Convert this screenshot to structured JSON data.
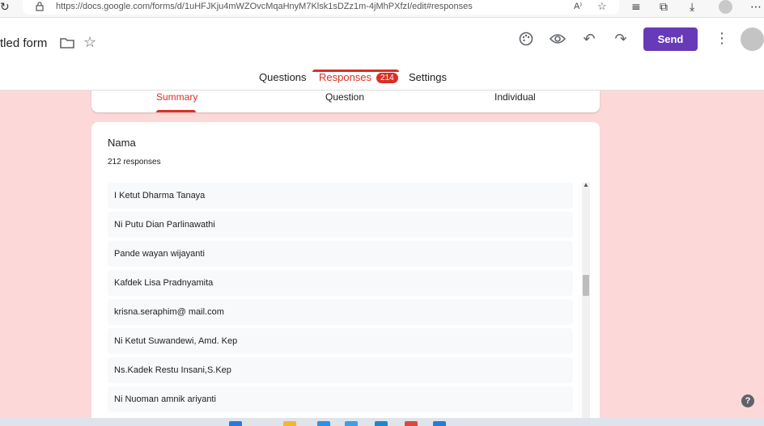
{
  "browser": {
    "url": "https://docs.google.com/forms/d/1uHFJKju4mWZOvcMqaHnyM7Klsk1sDZz1m-4jMhPXfzI/edit#responses"
  },
  "header": {
    "title": "tled form",
    "send_label": "Send"
  },
  "tabs": [
    {
      "label": "Questions"
    },
    {
      "label": "Responses",
      "badge": "214"
    },
    {
      "label": "Settings"
    }
  ],
  "subtabs": [
    {
      "label": "Summary"
    },
    {
      "label": "Question"
    },
    {
      "label": "Individual"
    }
  ],
  "question": {
    "title": "Nama",
    "count": "212 responses",
    "responses": [
      "I Ketut Dharma Tanaya",
      "Ni Putu Dian Parlinawathi",
      "Pande wayan wijayanti",
      "Kafdek Lisa Pradnyamita",
      "krisna.seraphim@ mail.com",
      "Ni Ketut Suwandewi, Amd. Kep",
      "Ns.Kadek Restu Insani,S.Kep",
      "Ni Nuoman amnik ariyanti"
    ]
  },
  "help_label": "?",
  "colors": {
    "accent": "#d93025",
    "send": "#673ab7",
    "background": "#fcd8d8"
  }
}
